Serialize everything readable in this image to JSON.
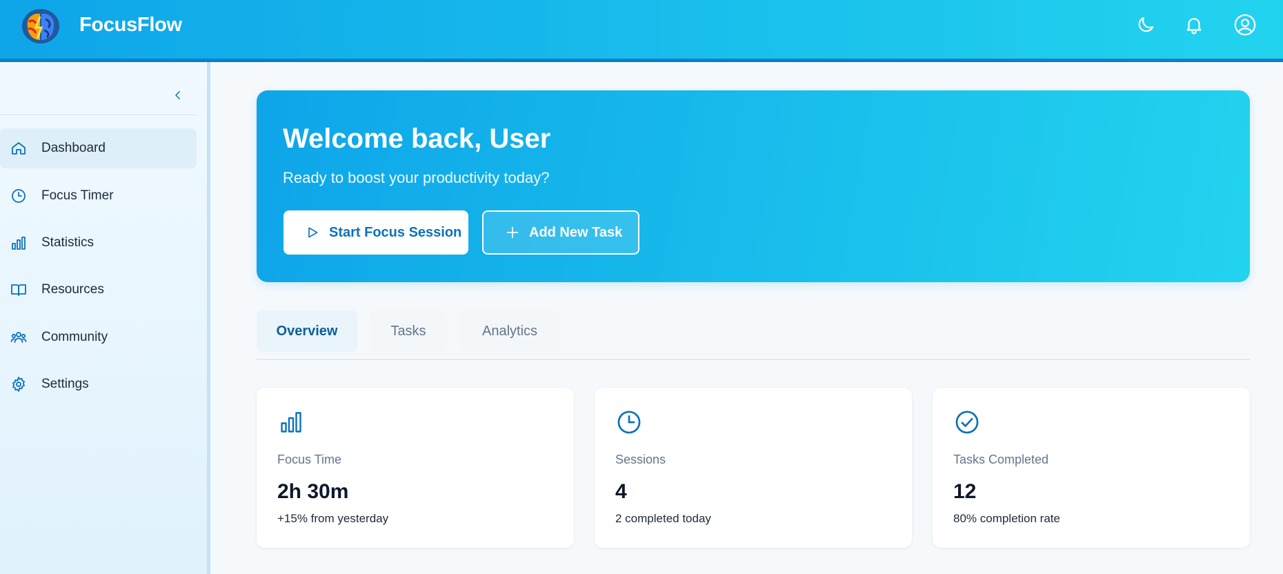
{
  "header": {
    "brand": "FocusFlow",
    "icons": [
      "moon-icon",
      "bell-icon",
      "user-circle-icon"
    ],
    "colors": {
      "gradient_start": "#0ea5e9",
      "gradient_end": "#22d3ee"
    }
  },
  "sidebar": {
    "collapse_icon": "chevron-left-icon",
    "items": [
      {
        "label": "Dashboard",
        "icon": "home-icon",
        "active": true
      },
      {
        "label": "Focus Timer",
        "icon": "clock-icon",
        "active": false
      },
      {
        "label": "Statistics",
        "icon": "bar-chart-icon",
        "active": false
      },
      {
        "label": "Resources",
        "icon": "book-icon",
        "active": false
      },
      {
        "label": "Community",
        "icon": "users-icon",
        "active": false
      },
      {
        "label": "Settings",
        "icon": "gear-icon",
        "active": false
      }
    ]
  },
  "hero": {
    "title": "Welcome back, User",
    "subtitle": "Ready to boost your productivity today?",
    "primary_button": "Start Focus Session",
    "secondary_button": "Add New Task"
  },
  "tabs": [
    {
      "label": "Overview",
      "active": true
    },
    {
      "label": "Tasks",
      "active": false
    },
    {
      "label": "Analytics",
      "active": false
    }
  ],
  "stats": [
    {
      "label": "Focus Time",
      "value": "2h 30m",
      "note": "+15% from yesterday",
      "icon": "bar-chart-icon"
    },
    {
      "label": "Sessions",
      "value": "4",
      "note": "2 completed today",
      "icon": "clock-icon"
    },
    {
      "label": "Tasks Completed",
      "value": "12",
      "note": "80% completion rate",
      "icon": "check-circle-icon"
    }
  ],
  "accent_color": "#0b72b9"
}
